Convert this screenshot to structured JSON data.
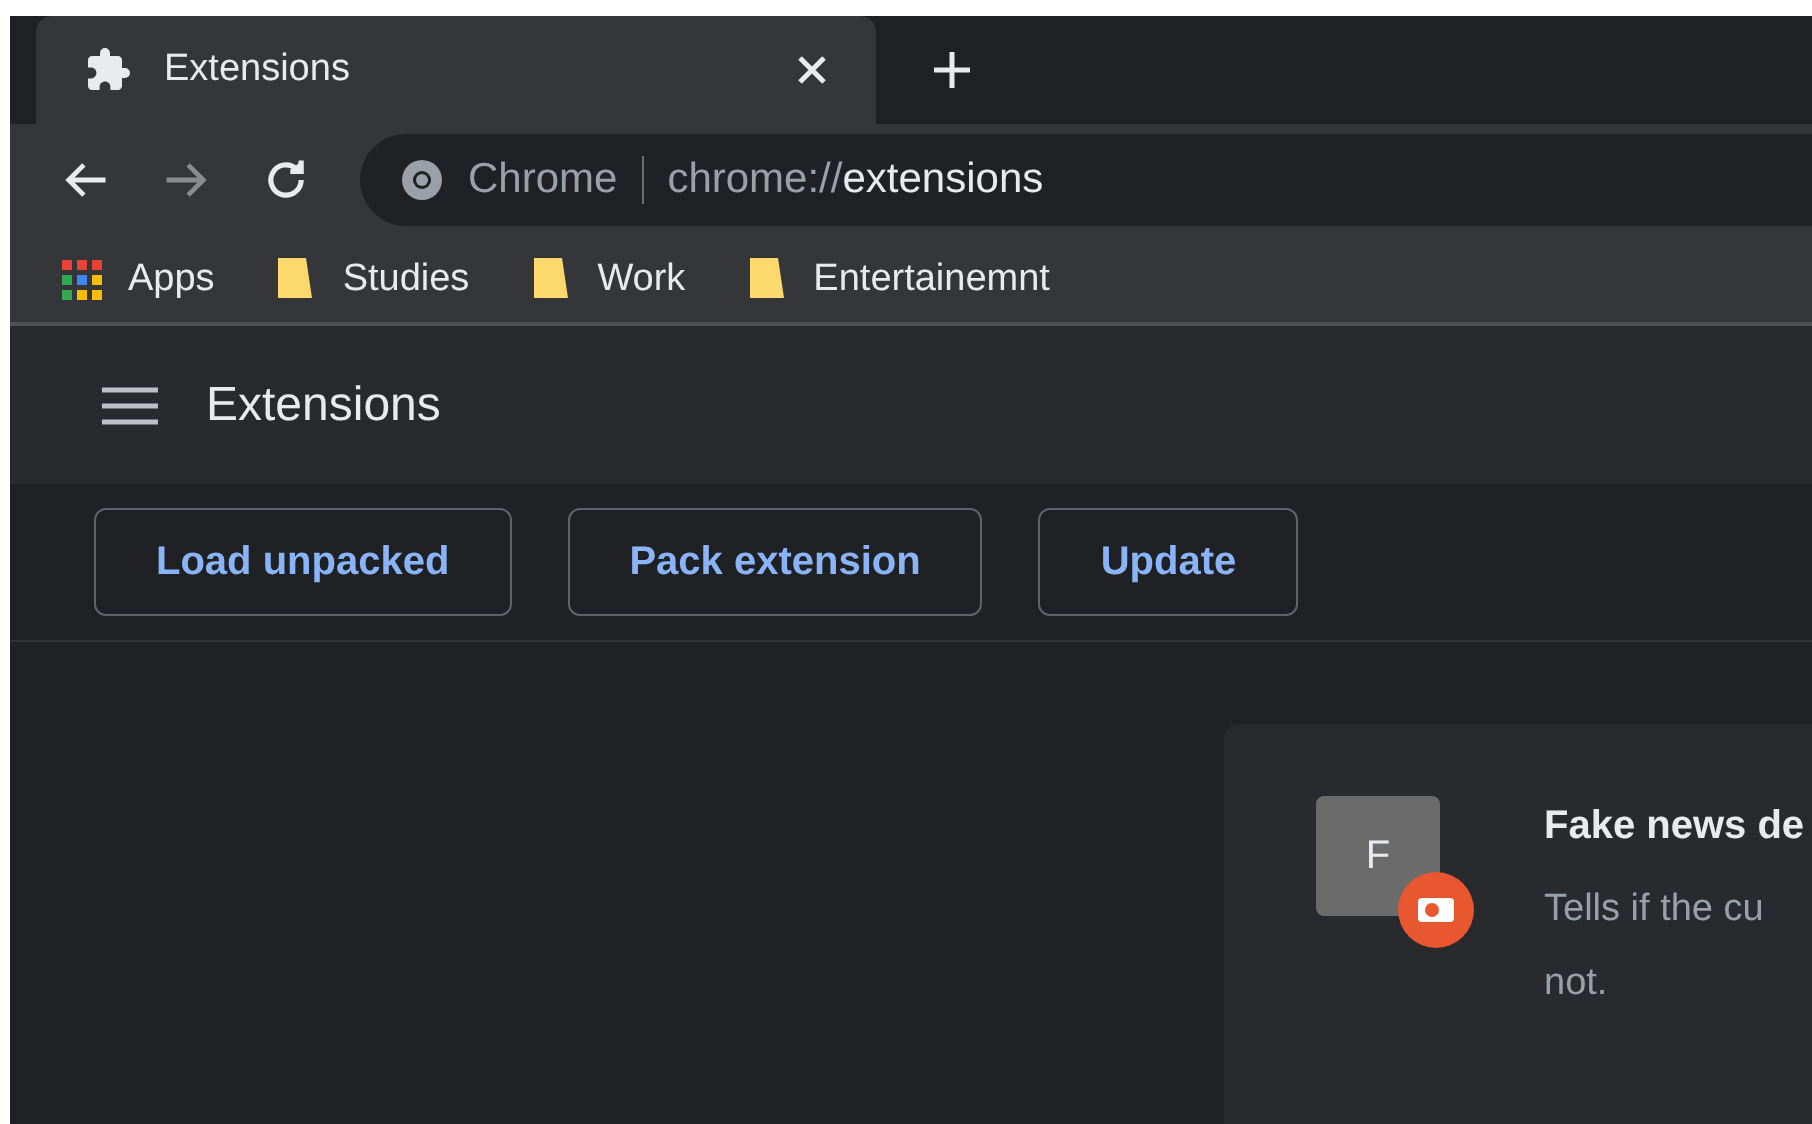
{
  "tab": {
    "title": "Extensions",
    "selected": true
  },
  "omnibox": {
    "site": "Chrome",
    "url_prefix": "chrome://",
    "url_path": "extensions"
  },
  "bookmarks": [
    {
      "label": "Apps",
      "kind": "apps"
    },
    {
      "label": "Studies",
      "kind": "folder"
    },
    {
      "label": "Work",
      "kind": "folder"
    },
    {
      "label": "Entertainemnt",
      "kind": "folder"
    }
  ],
  "header": {
    "title": "Extensions"
  },
  "actions": [
    "Load unpacked",
    "Pack extension",
    "Update"
  ],
  "extension": {
    "letter": "F",
    "name": "Fake news de",
    "description": "Tells if the cu",
    "description_line2": "not."
  }
}
